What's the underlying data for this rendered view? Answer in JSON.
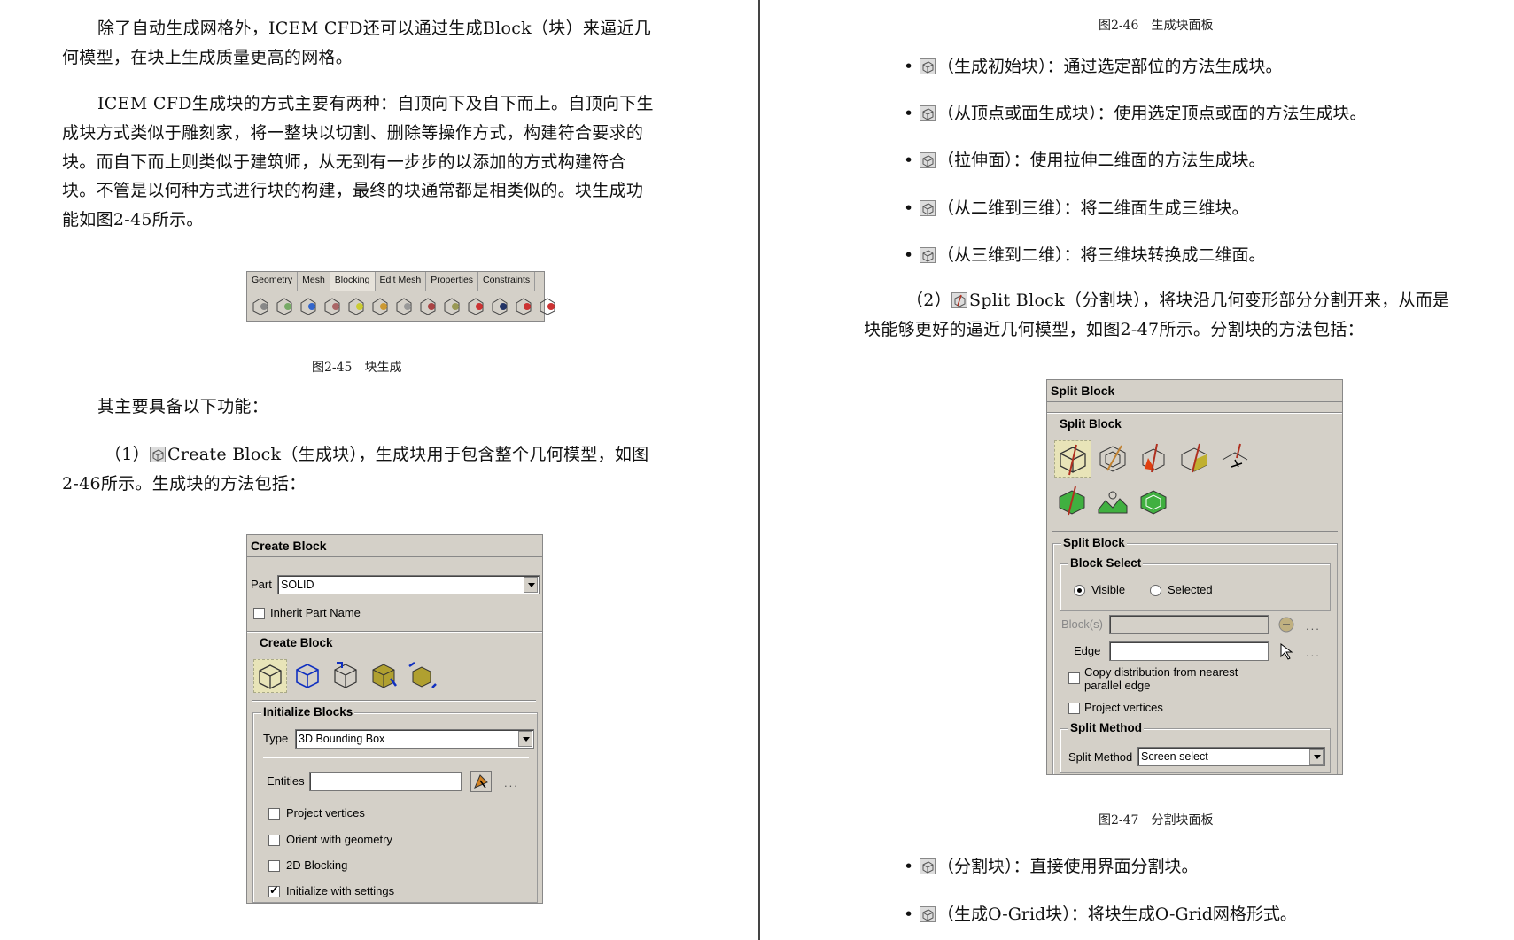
{
  "left": {
    "para1": "除了自动生成网格外，ICEM CFD还可以通过生成Block（块）来逼近几何模型，在块上生成质量更高的网格。",
    "para2": "ICEM CFD生成块的方式主要有两种：自顶向下及自下而上。自顶向下生成块方式类似于雕刻家，将一整块以切割、删除等操作方式，构建符合要求的块。而自下而上则类似于建筑师，从无到有一步步的以添加的方式构建符合块。不管是以何种方式进行块的构建，最终的块通常都是相类似的。块生成功能如图2-45所示。",
    "caption_245": "图2-45　块生成",
    "para3": "其主要具备以下功能：",
    "para4_prefix": "（1）",
    "para4_rest": "Create Block（生成块），生成块用于包含整个几何模型，如图2-46所示。生成块的方法包括："
  },
  "toolbar": {
    "tabs": [
      "Geometry",
      "Mesh",
      "Blocking",
      "Edit Mesh",
      "Properties",
      "Constraints"
    ],
    "active_tab": "Blocking",
    "icons": [
      "create-block-icon",
      "split-block-icon",
      "vertex-icon",
      "edit-block-icon",
      "associate-icon",
      "move-vertex-icon",
      "transform-icon",
      "edit-edge-icon",
      "premesh-params-icon",
      "quality-icon",
      "pre-mesh-icon",
      "check-blocks-icon",
      "delete-block-icon"
    ]
  },
  "create_block": {
    "title": "Create Block",
    "part_label": "Part",
    "part_value": "SOLID",
    "inherit_label": "Inherit Part Name",
    "group_title": "Create Block",
    "init_title": "Initialize Blocks",
    "type_label": "Type",
    "type_value": "3D Bounding Box",
    "entities_label": "Entities",
    "entities_value": "",
    "dots": "...",
    "project_vertices": "Project vertices",
    "orient_geometry": "Orient with geometry",
    "blocking_2d": "2D Blocking",
    "init_settings": "Initialize with settings"
  },
  "right": {
    "caption_246": "图2-46　生成块面板",
    "bullets": [
      "（生成初始块）：通过选定部位的方法生成块。",
      "（从顶点或面生成块）：使用选定顶点或面的方法生成块。",
      "（拉伸面）：使用拉伸二维面的方法生成块。",
      "（从二维到三维）：将二维面生成三维块。",
      "（从三维到二维）：将三维块转换成二维面。"
    ],
    "para5_prefix": "（2）",
    "para5_rest": "Split Block（分割块），将块沿几何变形部分分割开来，从而是块能够更好的逼近几何模型，如图2-47所示。分割块的方法包括：",
    "caption_247": "图2-47　分割块面板",
    "bullets2": [
      "（分割块）：直接使用界面分割块。",
      "（生成O-Grid块）：将块生成O-Grid网格形式。"
    ]
  },
  "split_block": {
    "title": "Split Block",
    "group_title": "Split Block",
    "sub_title": "Split Block",
    "select_title": "Block Select",
    "visible": "Visible",
    "selected": "Selected",
    "blocks_label": "Block(s)",
    "edge_label": "Edge",
    "dots": "...",
    "copy_dist": "Copy distribution from nearest parallel edge",
    "project_vertices": "Project vertices",
    "method_title": "Split Method",
    "method_label": "Split Method",
    "method_value": "Screen select"
  }
}
